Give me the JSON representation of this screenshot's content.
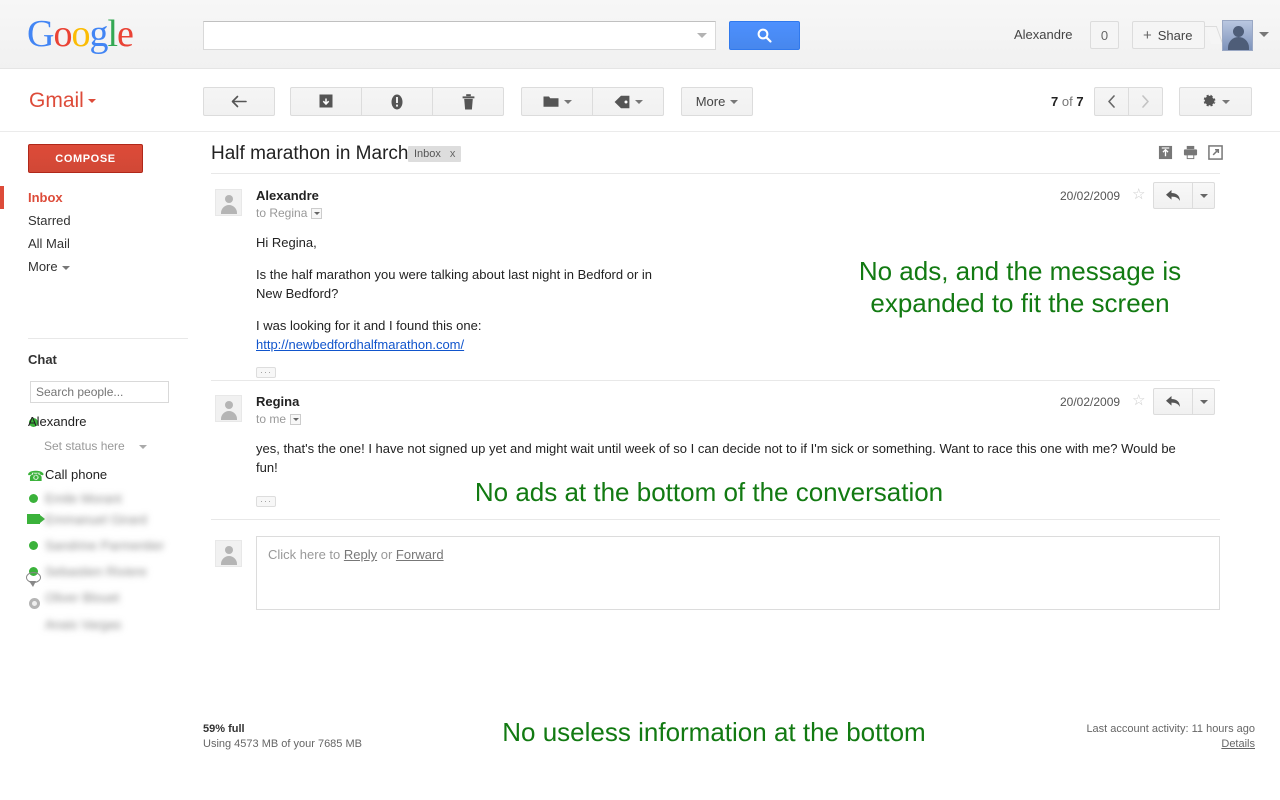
{
  "topbar": {
    "logo": "Google",
    "search": {
      "value": "",
      "placeholder": ""
    },
    "search_button_icon": "search-icon",
    "account_name": "Alexandre",
    "notification_count": "0",
    "share_label": "Share",
    "share_plus": "+"
  },
  "toolbar": {
    "back_icon": "back-arrow-icon",
    "archive_icon": "archive-icon",
    "spam_icon": "report-spam-icon",
    "delete_icon": "trash-icon",
    "move_icon": "folder-icon",
    "label_icon": "label-tag-icon",
    "more_label": "More",
    "pager_prefix": "7",
    "pager_mid": " of ",
    "pager_total": "7",
    "prev_icon": "chevron-left-icon",
    "next_icon": "chevron-right-icon",
    "settings_icon": "gear-icon"
  },
  "sidebar": {
    "gmail_label": "Gmail",
    "compose_label": "COMPOSE",
    "items": [
      {
        "label": "Inbox",
        "active": true
      },
      {
        "label": "Starred",
        "active": false
      },
      {
        "label": "All Mail",
        "active": false
      },
      {
        "label": "More",
        "active": false
      }
    ],
    "chat": {
      "title": "Chat",
      "search_placeholder": "Search people...",
      "me": "Alexandre",
      "status": "Set status here",
      "call_phone": "Call phone",
      "contacts": [
        {
          "name": "Emile Morant",
          "icon": "status-online-dot"
        },
        {
          "name": "Emmanuel Girard",
          "icon": "video-camera-icon"
        },
        {
          "name": "Sandrine Parmentier",
          "icon": "status-online-dot"
        },
        {
          "name": "Sebastien Riviere",
          "icon": "status-online-dot"
        },
        {
          "name": "Oliver Blouet",
          "icon": "chat-bubble-icon"
        },
        {
          "name": "Anais Vargas",
          "icon": "status-offline-dot"
        }
      ]
    }
  },
  "conversation": {
    "subject": "Half marathon in March",
    "label": "Inbox",
    "label_close": "x",
    "icons": [
      "collapse-all-icon",
      "print-icon",
      "popout-window-icon"
    ],
    "messages": [
      {
        "sender": "Alexandre",
        "to": "to Regina",
        "date": "20/02/2009",
        "paragraphs": [
          "Hi Regina,",
          "Is the half marathon you were talking about last night in Bedford or in New Bedford?"
        ],
        "tail_text": "I was looking for it and I found this one:",
        "link": "http://newbedfordhalfmarathon.com/",
        "expand_label": "···"
      },
      {
        "sender": "Regina",
        "to": "to me",
        "date": "20/02/2009",
        "paragraphs": [
          "yes, that's the one!  I have not signed up yet and might wait until week of so I can decide not to if I'm sick or something.  Want to race this one with me? Would be fun!"
        ],
        "tail_text": "",
        "link": "",
        "expand_label": "···"
      }
    ],
    "reply_prompt_pre": "Click here to ",
    "reply_link": "Reply",
    "reply_prompt_mid": " or ",
    "forward_link": "Forward"
  },
  "footer": {
    "quota_percent": "59% full",
    "quota_detail": "Using 4573 MB of your 7685 MB",
    "activity": "Last account activity: 11 hours ago",
    "details_link": "Details"
  },
  "annotations": [
    {
      "text": "No ads, and the message is\nexpanded to fit the screen"
    },
    {
      "text": "No ads at the bottom of the conversation"
    },
    {
      "text": "No useless information at the bottom"
    }
  ],
  "colors": {
    "brand_red": "#dd4b39",
    "link_blue": "#1155cc",
    "button_blue": "#4d90fe",
    "annotation_green": "#127a12",
    "online_green": "#3bb23b"
  }
}
